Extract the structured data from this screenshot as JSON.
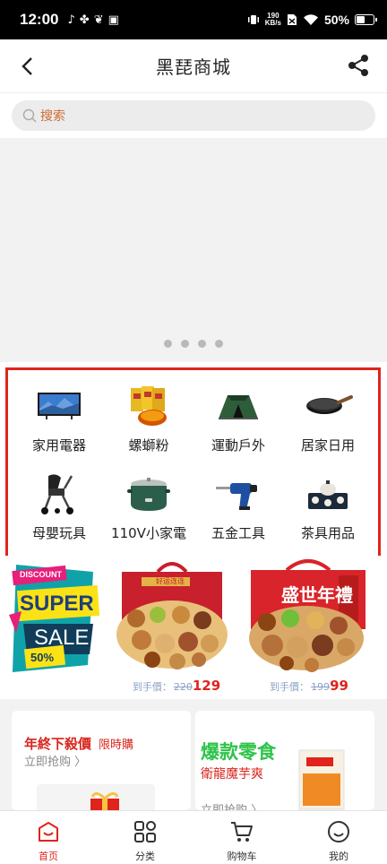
{
  "status_bar": {
    "time": "12:00",
    "net_speed_value": "190",
    "net_speed_unit": "KB/s",
    "battery": "50%",
    "battery_level": 0.5
  },
  "header": {
    "title": "黑琵商城"
  },
  "search": {
    "placeholder": "搜索"
  },
  "banner": {
    "dot_count": 4
  },
  "categories": [
    {
      "label": "家用電器",
      "icon": "tv-icon"
    },
    {
      "label": "螺螄粉",
      "icon": "noodle-packs-icon"
    },
    {
      "label": "運動戶外",
      "icon": "tent-icon"
    },
    {
      "label": "居家日用",
      "icon": "wok-pan-icon"
    },
    {
      "label": "母嬰玩具",
      "icon": "stroller-icon"
    },
    {
      "label": "110V小家電",
      "icon": "electric-pot-icon"
    },
    {
      "label": "五金工具",
      "icon": "power-drill-icon"
    },
    {
      "label": "茶具用品",
      "icon": "tea-set-icon"
    }
  ],
  "promo": {
    "sale_top": "DISCOUNT",
    "sale_main": "SUPER",
    "sale_word": "SALE",
    "sale_pct": "50%",
    "card1": {
      "gift_text": "好运连连",
      "price_label": "到手價：",
      "price_old": "220",
      "price_new": "129"
    },
    "card2": {
      "gift_text": "盛世年禮",
      "price_label": "到手價：",
      "price_old": "199",
      "price_new": "99"
    }
  },
  "deals": {
    "left": {
      "title": "年終下殺價",
      "subtitle": "限時購",
      "link": "立即抢购 〉"
    },
    "right": {
      "title": "爆款零食",
      "subtitle": "衛龍魔芋爽",
      "link": "立即抢购 〉"
    }
  },
  "bottom_nav": [
    {
      "label": "首页",
      "active": true
    },
    {
      "label": "分类",
      "active": false
    },
    {
      "label": "购物车",
      "active": false
    },
    {
      "label": "我的",
      "active": false
    }
  ],
  "colors": {
    "accent_red": "#e0241c",
    "green": "#2ec34a",
    "search_text": "#d06a30"
  }
}
